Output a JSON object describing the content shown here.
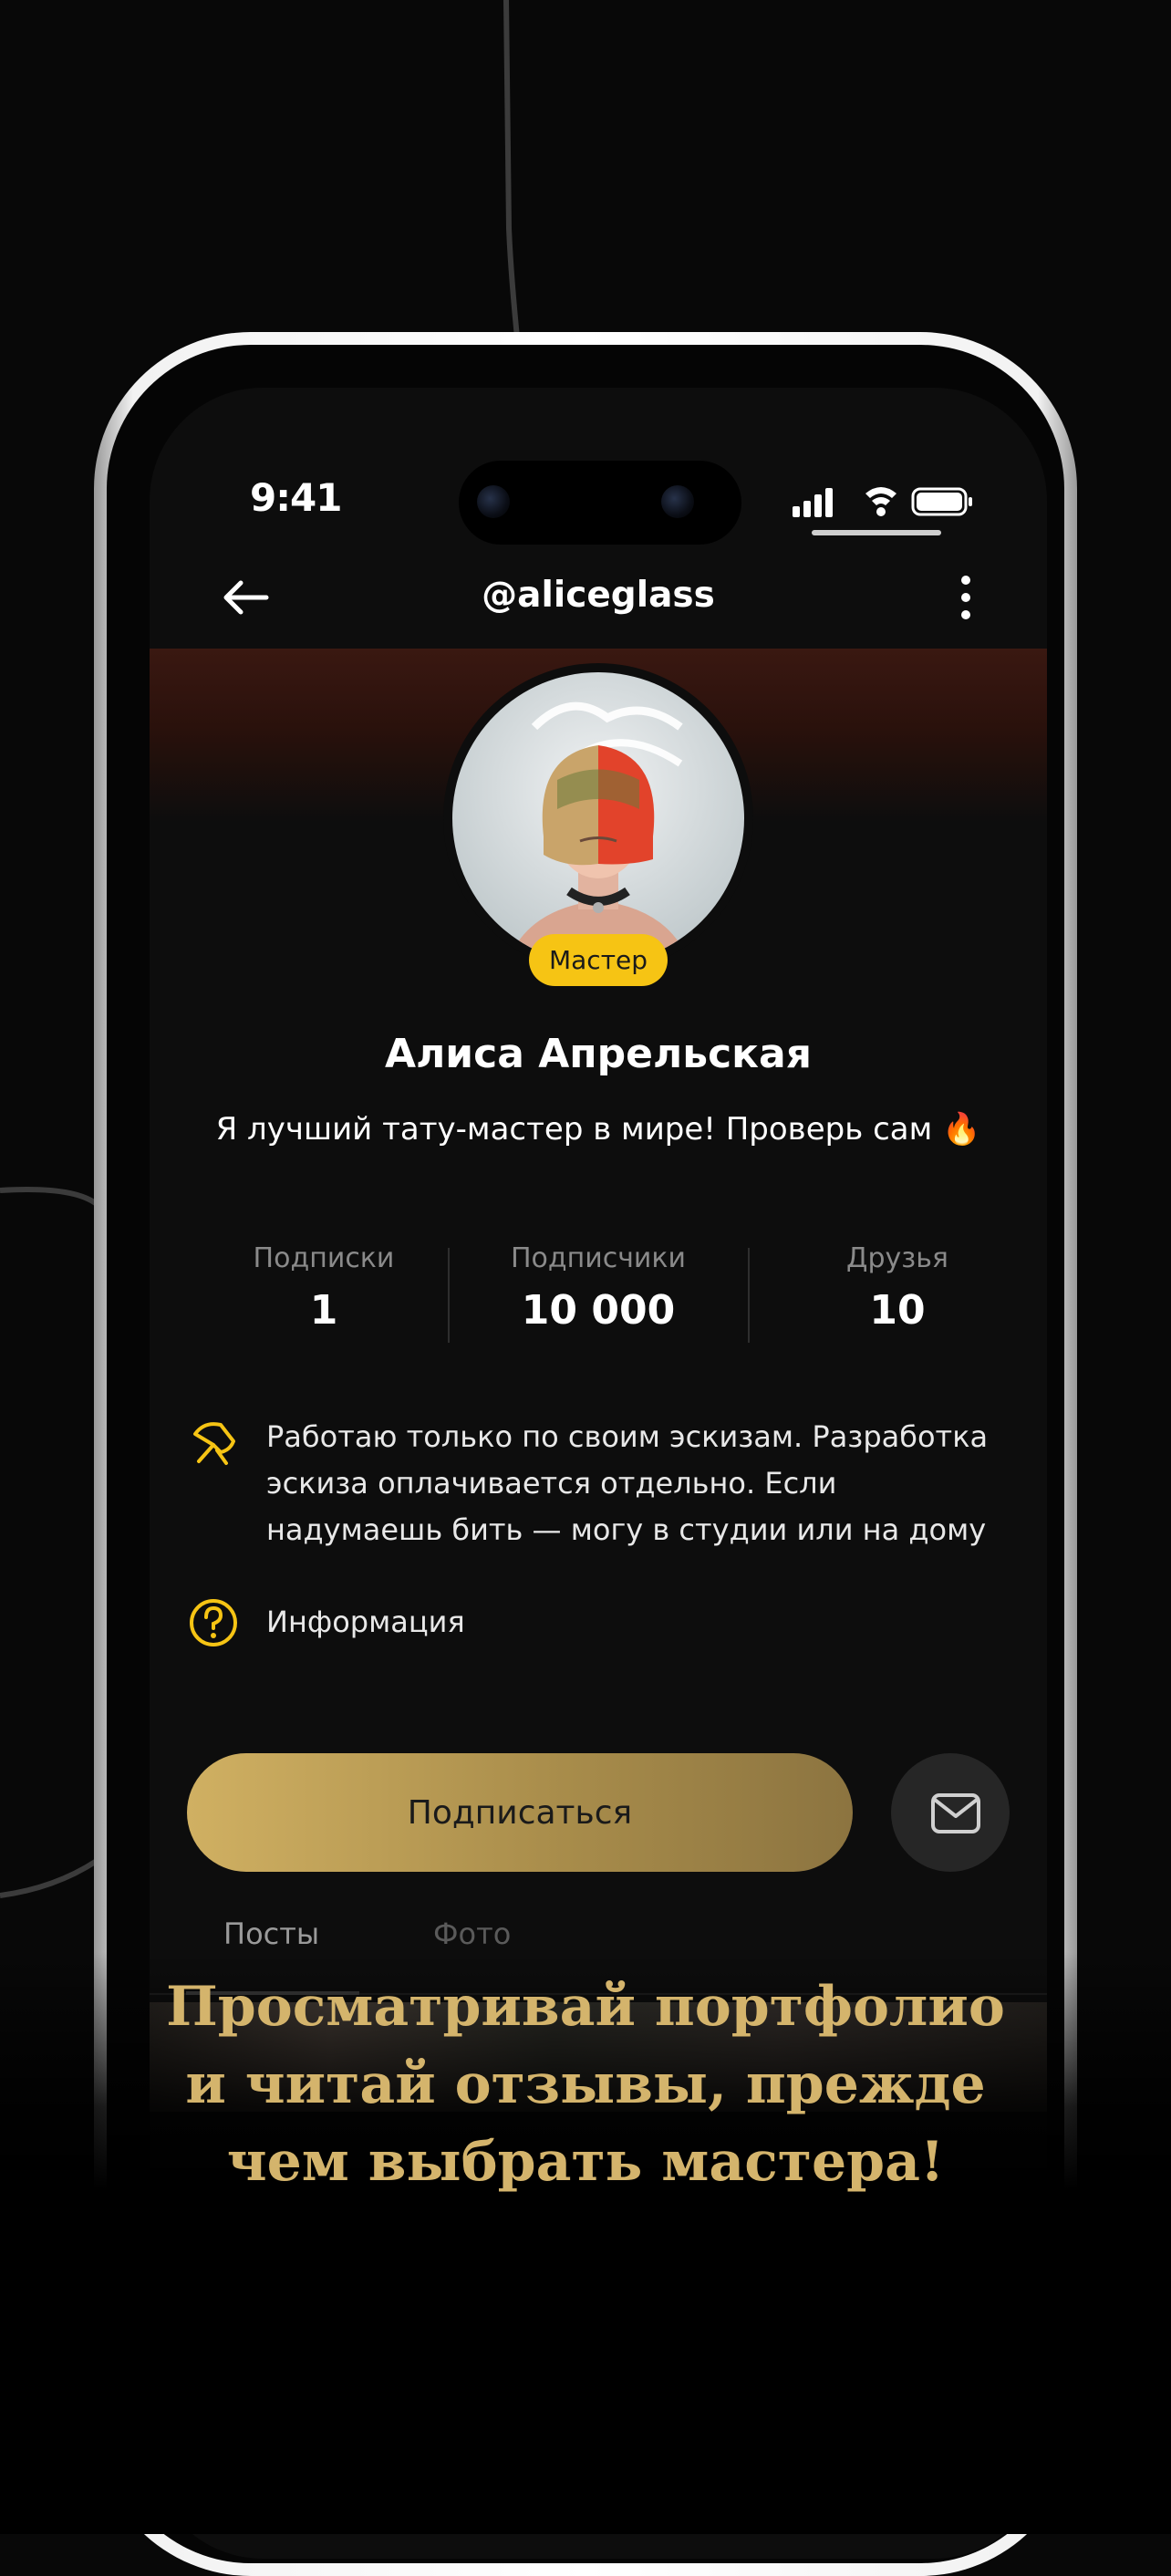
{
  "status_bar": {
    "time": "9:41"
  },
  "nav": {
    "title": "@aliceglass"
  },
  "profile": {
    "role_badge": "Мастер",
    "name": "Алиса Апрельская",
    "bio": "Я лучший тату-мастер в мире! Проверь сам 🔥"
  },
  "stats": [
    {
      "label": "Подписки",
      "value": "1"
    },
    {
      "label": "Подписчики",
      "value": "10 000"
    },
    {
      "label": "Друзья",
      "value": "10"
    }
  ],
  "details": {
    "note": "Работаю только по своим эскизам. Разработка эскиза оплачивается отдельно. Если надумаешь бить — могу в студии или на дому",
    "info_label": "Информация"
  },
  "actions": {
    "subscribe_label": "Подписаться"
  },
  "tabs": [
    {
      "label": "Посты"
    },
    {
      "label": "Фото"
    }
  ],
  "promo": {
    "line1": "Просматривай портфолио",
    "line2": "и читай отзывы, прежде",
    "line3": "чем выбрать мастера!"
  },
  "colors": {
    "accent_gold": "#d4b46c",
    "badge_yellow": "#f6c414",
    "background": "#080808"
  },
  "icons": [
    "back-arrow-icon",
    "more-vertical-icon",
    "signal-icon",
    "wifi-icon",
    "battery-icon",
    "needle-icon",
    "question-circle-icon",
    "mail-icon"
  ]
}
